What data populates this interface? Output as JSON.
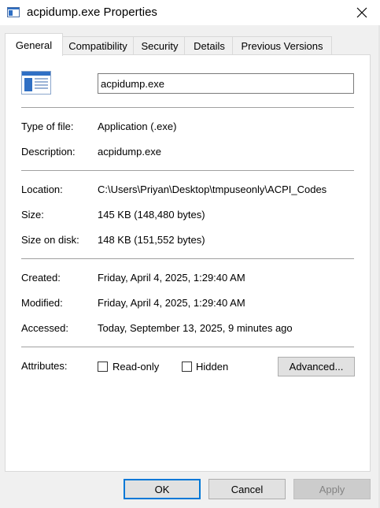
{
  "window": {
    "title": "acpidump.exe Properties",
    "close_icon": "close-icon"
  },
  "tabs": [
    {
      "label": "General",
      "active": true
    },
    {
      "label": "Compatibility",
      "active": false
    },
    {
      "label": "Security",
      "active": false
    },
    {
      "label": "Details",
      "active": false
    },
    {
      "label": "Previous Versions",
      "active": false
    }
  ],
  "general": {
    "filename": "acpidump.exe",
    "type_label": "Type of file:",
    "type_value": "Application (.exe)",
    "description_label": "Description:",
    "description_value": "acpidump.exe",
    "location_label": "Location:",
    "location_value": "C:\\Users\\Priyan\\Desktop\\tmpuseonly\\ACPI_Codes",
    "size_label": "Size:",
    "size_value": "145 KB (148,480 bytes)",
    "size_on_disk_label": "Size on disk:",
    "size_on_disk_value": "148 KB (151,552 bytes)",
    "created_label": "Created:",
    "created_value": "Friday, April 4, 2025, 1:29:40 AM",
    "modified_label": "Modified:",
    "modified_value": "Friday, April 4, 2025, 1:29:40 AM",
    "accessed_label": "Accessed:",
    "accessed_value": "Today, September 13, 2025, 9 minutes ago",
    "attributes_label": "Attributes:",
    "readonly_label": "Read-only",
    "readonly_checked": false,
    "hidden_label": "Hidden",
    "hidden_checked": false,
    "advanced_label": "Advanced..."
  },
  "footer": {
    "ok_label": "OK",
    "cancel_label": "Cancel",
    "apply_label": "Apply"
  },
  "colors": {
    "accent": "#0078d7",
    "window_bg": "#f0f0f0",
    "panel_bg": "#ffffff"
  }
}
